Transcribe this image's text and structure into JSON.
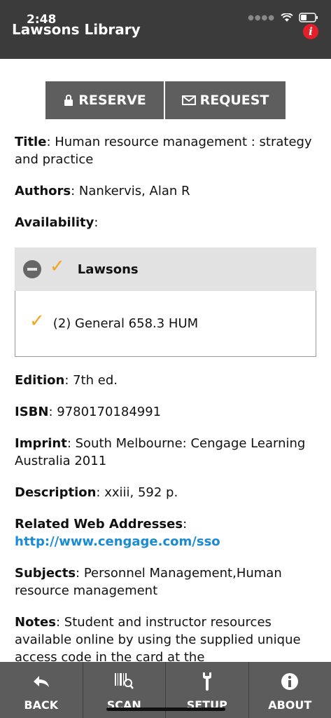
{
  "status_bar": {
    "time": "2:48"
  },
  "header": {
    "title": "Lawsons Library"
  },
  "actions": {
    "reserve": "RESERVE",
    "request": "REQUEST"
  },
  "record": {
    "title_label": "Title",
    "title_value": "Human resource management : strategy and practice",
    "authors_label": "Authors",
    "authors_value": "Nankervis, Alan R",
    "availability_label": "Availability",
    "availability": {
      "branch": "Lawsons",
      "item": "(2) General 658.3 HUM"
    },
    "edition_label": "Edition",
    "edition_value": "7th ed.",
    "isbn_label": "ISBN",
    "isbn_value": "9780170184991",
    "imprint_label": "Imprint",
    "imprint_value": "South Melbourne: Cengage Learning Australia 2011",
    "description_label": "Description",
    "description_value": "xxiii, 592 p.",
    "related_label": "Related Web Addresses",
    "related_url": "http://www.cengage.com/sso",
    "subjects_label": "Subjects",
    "subjects_value": "Personnel Management,Human resource management",
    "notes_label": "Notes",
    "notes_value": "Student and instructor resources available online by using the supplied unique access code in the card at the"
  },
  "tabbar": {
    "back": "BACK",
    "scan": "SCAN",
    "setup": "SETUP",
    "about": "ABOUT"
  },
  "colors": {
    "header_bg": "#3b3b3b",
    "button_bg": "#5e5e5e",
    "check": "#f4a41c",
    "link": "#1a8bd0",
    "badge": "#e3202a"
  }
}
